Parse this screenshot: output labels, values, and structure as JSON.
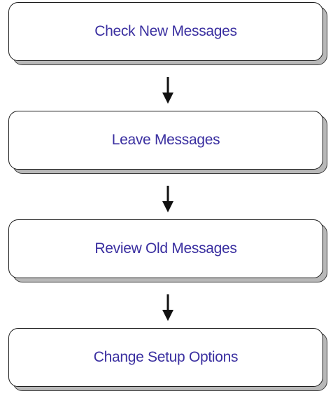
{
  "steps": [
    {
      "label": "Check New Messages"
    },
    {
      "label": "Leave Messages"
    },
    {
      "label": "Review Old Messages"
    },
    {
      "label": "Change Setup Options"
    }
  ],
  "colors": {
    "label_text": "#3a2fa0",
    "box_border": "#1a1a1a",
    "box_shadow": "#b8b8b8",
    "arrow": "#111111"
  }
}
